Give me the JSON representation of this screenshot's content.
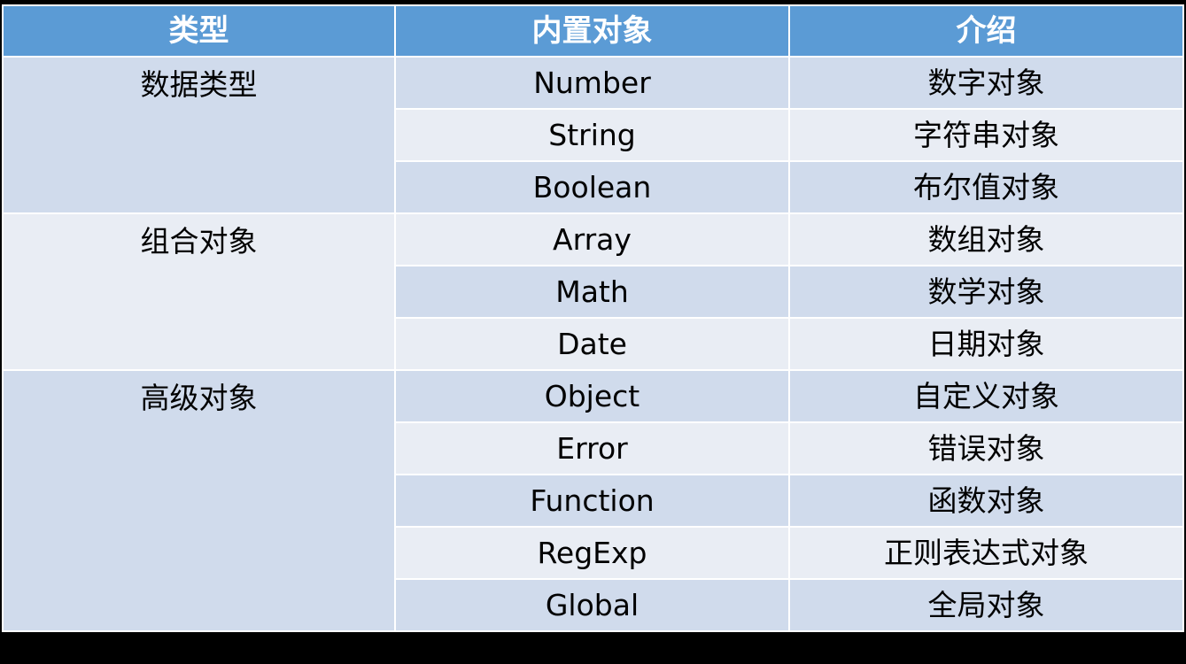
{
  "header": {
    "col1": "类型",
    "col2": "内置对象",
    "col3": "介绍"
  },
  "groups": [
    {
      "category": "数据类型",
      "rows": [
        {
          "object": "Number",
          "desc": "数字对象"
        },
        {
          "object": "String",
          "desc": "字符串对象"
        },
        {
          "object": "Boolean",
          "desc": "布尔值对象"
        }
      ]
    },
    {
      "category": "组合对象",
      "rows": [
        {
          "object": "Array",
          "desc": "数组对象"
        },
        {
          "object": "Math",
          "desc": "数学对象"
        },
        {
          "object": "Date",
          "desc": "日期对象"
        }
      ]
    },
    {
      "category": "高级对象",
      "rows": [
        {
          "object": "Object",
          "desc": "自定义对象"
        },
        {
          "object": "Error",
          "desc": "错误对象"
        },
        {
          "object": "Function",
          "desc": "函数对象"
        },
        {
          "object": "RegExp",
          "desc": "正则表达式对象"
        },
        {
          "object": "Global",
          "desc": "全局对象"
        }
      ]
    }
  ],
  "colors": {
    "header": "#5b9bd5",
    "row_dark": "#d0dbec",
    "row_light": "#e9edf4"
  }
}
